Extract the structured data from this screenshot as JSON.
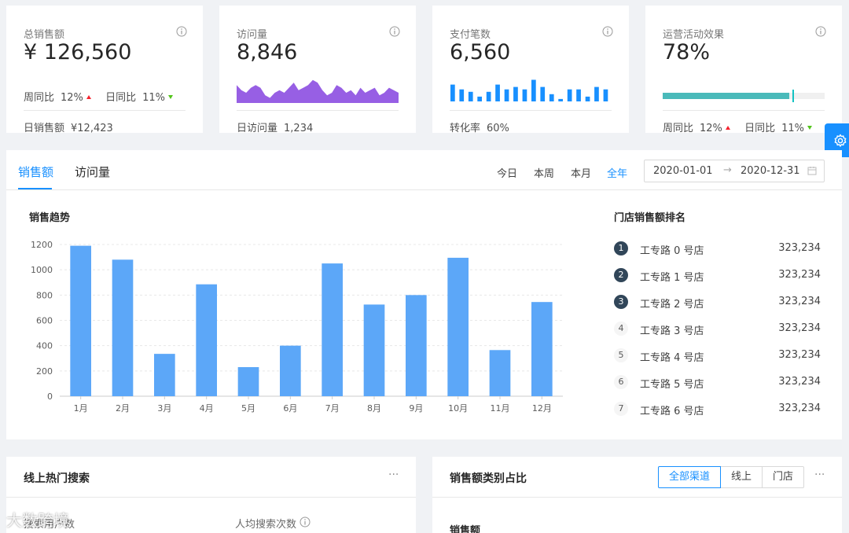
{
  "stats": {
    "sales": {
      "label": "总销售额",
      "value": "¥ 126,560",
      "trends": [
        {
          "label": "周同比",
          "value": "12%",
          "dir": "up"
        },
        {
          "label": "日同比",
          "value": "11%",
          "dir": "down"
        }
      ],
      "footer_label": "日销售额",
      "footer_value": "¥12,423"
    },
    "visits": {
      "label": "访问量",
      "value": "8,846",
      "footer_label": "日访问量",
      "footer_value": "1,234",
      "area_values": [
        7,
        5,
        4,
        6,
        7,
        6,
        3,
        2,
        4,
        5,
        4,
        6,
        8,
        5,
        6,
        7,
        9,
        8,
        5,
        3,
        4,
        7,
        6,
        4,
        5,
        3,
        6,
        4,
        5,
        6,
        3,
        4,
        6,
        5,
        4
      ],
      "color": "#975fe4"
    },
    "payments": {
      "label": "支付笔数",
      "value": "6,560",
      "footer_label": "转化率",
      "footer_value": "60%",
      "bar_values": [
        7,
        5,
        4,
        2,
        4,
        7,
        5,
        6,
        5,
        9,
        6,
        3,
        1,
        5,
        5,
        2,
        6,
        5
      ],
      "color": "#1890ff"
    },
    "campaign": {
      "label": "运营活动效果",
      "value": "78%",
      "progress": 0.78,
      "target": 0.8,
      "trends": [
        {
          "label": "周同比",
          "value": "12%",
          "dir": "up"
        },
        {
          "label": "日同比",
          "value": "11%",
          "dir": "down"
        }
      ]
    }
  },
  "sales_panel": {
    "tabs": [
      "销售额",
      "访问量"
    ],
    "ranges": [
      "今日",
      "本周",
      "本月",
      "全年"
    ],
    "active_range": "全年",
    "date_start": "2020-01-01",
    "date_sep": "→",
    "date_end": "2020-12-31",
    "trend_title": "销售趋势",
    "rank_title": "门店销售额排名",
    "ranking": [
      {
        "rank": "1",
        "name": "工专路 0 号店",
        "value": "323,234"
      },
      {
        "rank": "2",
        "name": "工专路 1 号店",
        "value": "323,234"
      },
      {
        "rank": "3",
        "name": "工专路 2 号店",
        "value": "323,234"
      },
      {
        "rank": "4",
        "name": "工专路 3 号店",
        "value": "323,234"
      },
      {
        "rank": "5",
        "name": "工专路 4 号店",
        "value": "323,234"
      },
      {
        "rank": "6",
        "name": "工专路 5 号店",
        "value": "323,234"
      },
      {
        "rank": "7",
        "name": "工专路 6 号店",
        "value": "323,234"
      }
    ]
  },
  "chart_data": {
    "type": "bar",
    "title": "销售趋势",
    "categories": [
      "1月",
      "2月",
      "3月",
      "4月",
      "5月",
      "6月",
      "7月",
      "8月",
      "9月",
      "10月",
      "11月",
      "12月"
    ],
    "values": [
      1190,
      1080,
      335,
      885,
      230,
      400,
      1050,
      725,
      800,
      1095,
      365,
      745
    ],
    "ylim": [
      0,
      1200
    ],
    "yticks": [
      "0",
      "200",
      "400",
      "600",
      "800",
      "1000",
      "1200"
    ],
    "grid": true,
    "color": "#5ca7f8"
  },
  "hot_search": {
    "title": "线上热门搜索",
    "more": "···",
    "label_a": "搜索用户数",
    "label_b": "人均搜索次数"
  },
  "category": {
    "title": "销售额类别占比",
    "more": "···",
    "options": [
      "全部渠道",
      "线上",
      "门店"
    ],
    "active": "全部渠道",
    "sub_title": "销售额"
  },
  "watermark": "大数跨境"
}
